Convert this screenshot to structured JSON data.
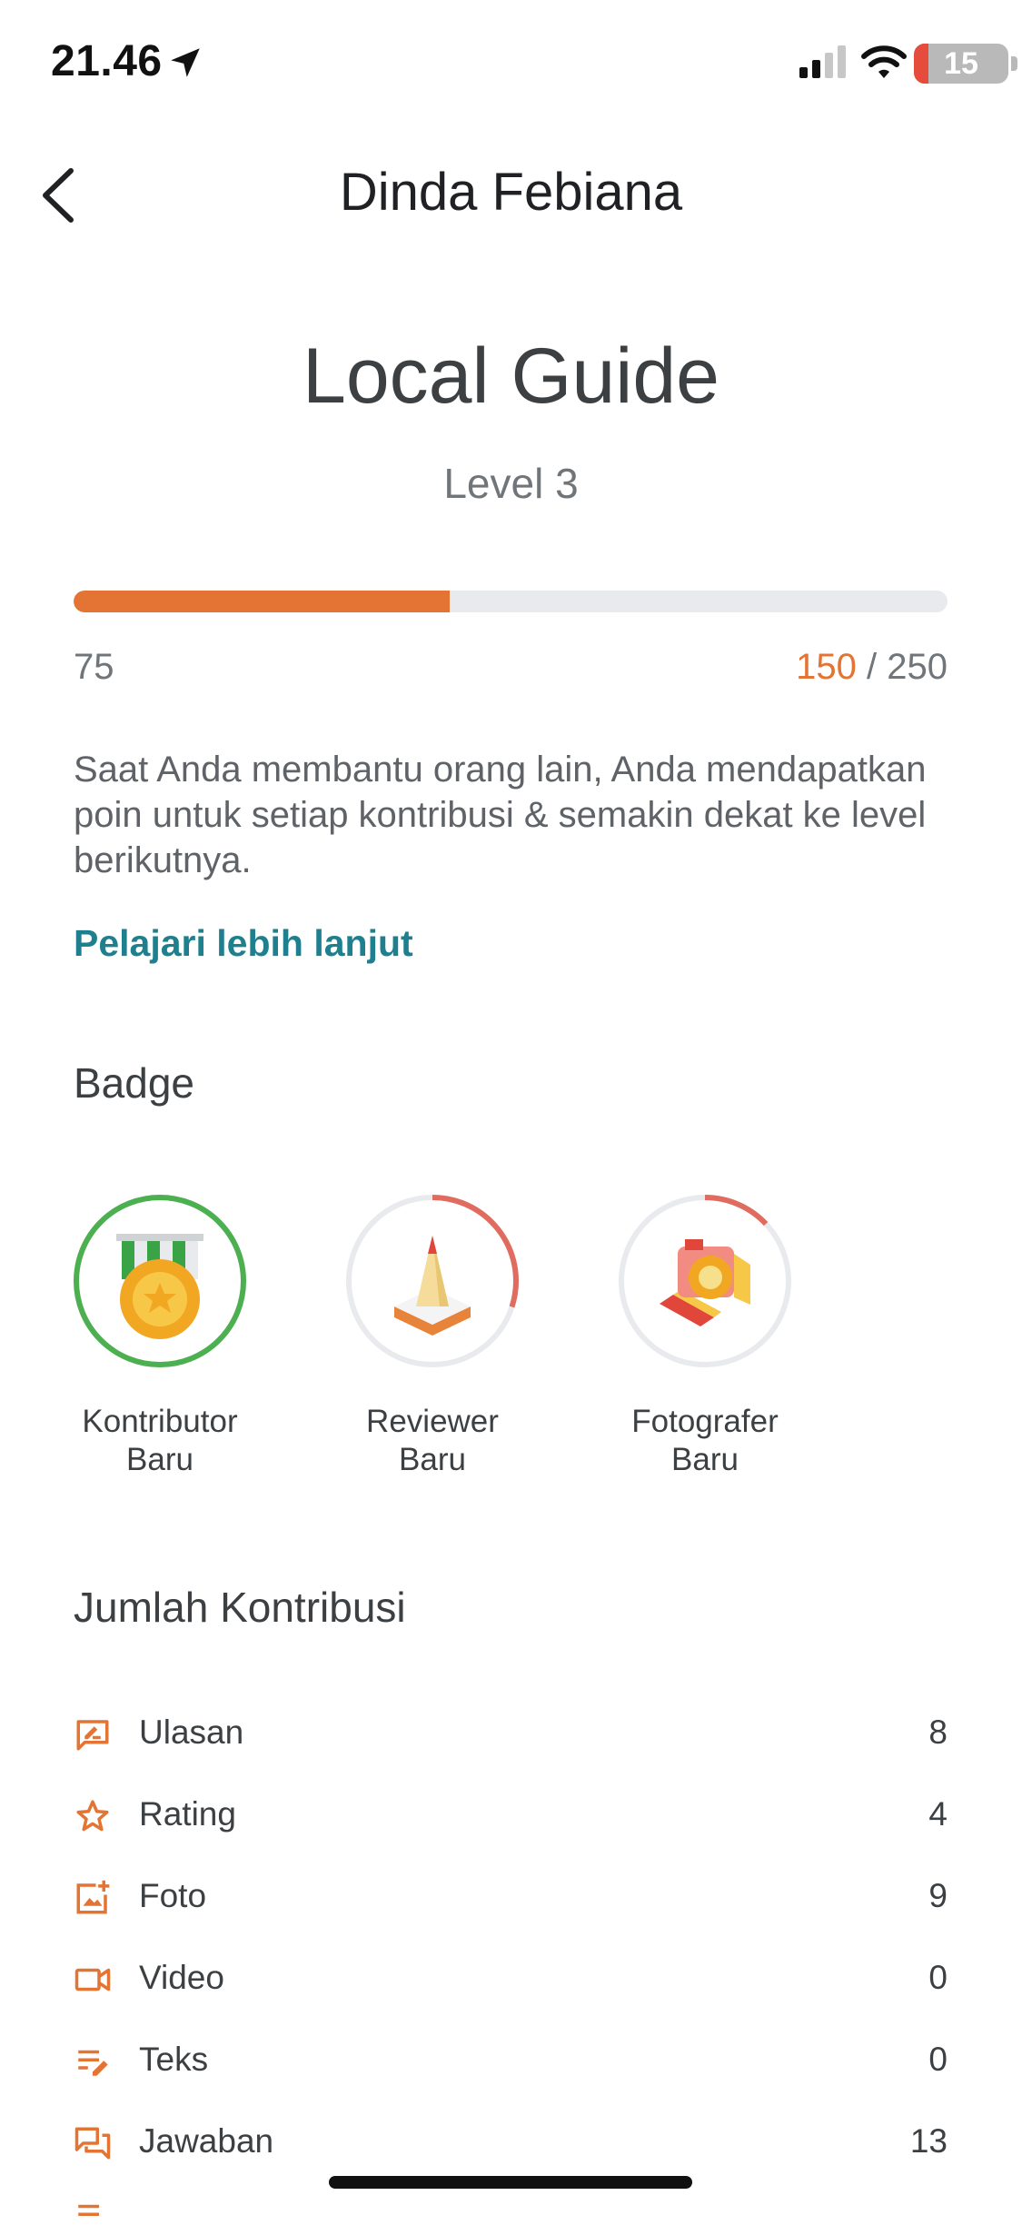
{
  "status_bar": {
    "time": "21.46",
    "battery": "15",
    "battery_level": 0.15
  },
  "header": {
    "title": "Dinda Febiana"
  },
  "program": {
    "title": "Local Guide",
    "level": "Level 3"
  },
  "progress": {
    "start": "75",
    "current": "150",
    "separator": "/",
    "end": "250",
    "fraction": 0.43
  },
  "description": "Saat Anda membantu orang lain, Anda mendapatkan poin untuk setiap kontribusi & semakin dekat ke level berikutnya.",
  "learn_more": "Pelajari lebih lanjut",
  "badges": {
    "title": "Badge",
    "items": [
      {
        "label": "Kontributor\nBaru",
        "progress": 1.0,
        "ring_color": "#4caf50"
      },
      {
        "label": "Reviewer\nBaru",
        "progress": 0.3,
        "ring_color": "#e06b5f"
      },
      {
        "label": "Fotografer\nBaru",
        "progress": 0.13,
        "ring_color": "#e06b5f"
      }
    ]
  },
  "contributions": {
    "title": "Jumlah Kontribusi",
    "items": [
      {
        "icon": "review-icon",
        "label": "Ulasan",
        "value": "8"
      },
      {
        "icon": "star-icon",
        "label": "Rating",
        "value": "4"
      },
      {
        "icon": "add-photo-icon",
        "label": "Foto",
        "value": "9"
      },
      {
        "icon": "video-icon",
        "label": "Video",
        "value": "0"
      },
      {
        "icon": "edit-text-icon",
        "label": "Teks",
        "value": "0"
      },
      {
        "icon": "answers-icon",
        "label": "Jawaban",
        "value": "13"
      }
    ]
  },
  "colors": {
    "accent": "#e37433",
    "link": "#1e7f8f",
    "complete": "#4caf50",
    "partial": "#e06b5f"
  }
}
